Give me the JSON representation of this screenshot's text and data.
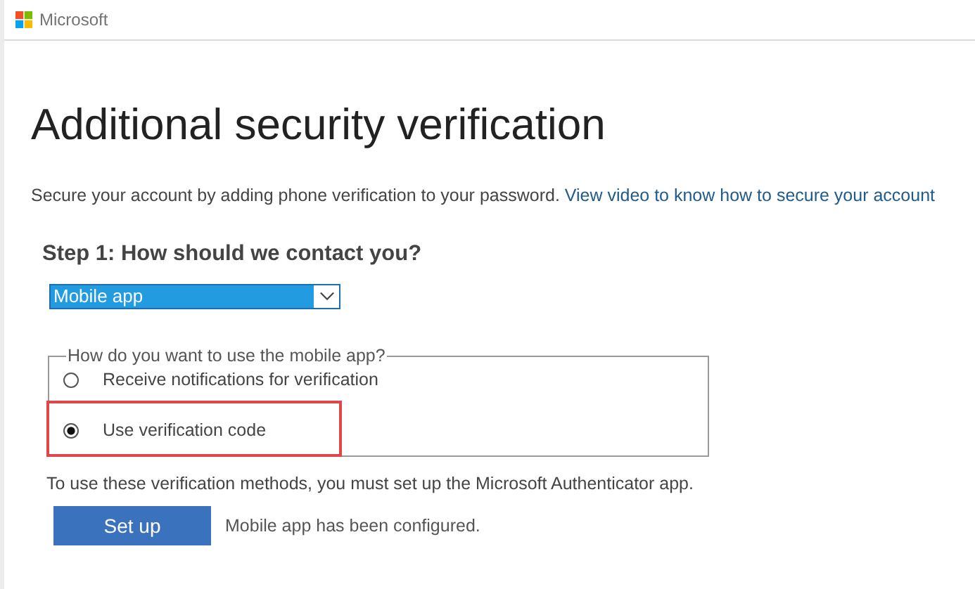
{
  "header": {
    "brand": "Microsoft"
  },
  "title": "Additional security verification",
  "intro": {
    "text": "Secure your account by adding phone verification to your password.",
    "link": "View video to know how to secure your account"
  },
  "step": {
    "heading": "Step 1: How should we contact you?",
    "method": {
      "value": "Mobile app"
    }
  },
  "options": {
    "legend": "How do you want to use the mobile app?",
    "items": [
      {
        "label": "Receive notifications for verification",
        "selected": false,
        "highlighted": false
      },
      {
        "label": "Use verification code",
        "selected": true,
        "highlighted": true
      }
    ]
  },
  "note": "To use these verification methods, you must set up the Microsoft Authenticator app.",
  "setup": {
    "button": "Set up",
    "status": "Mobile app has been configured."
  }
}
